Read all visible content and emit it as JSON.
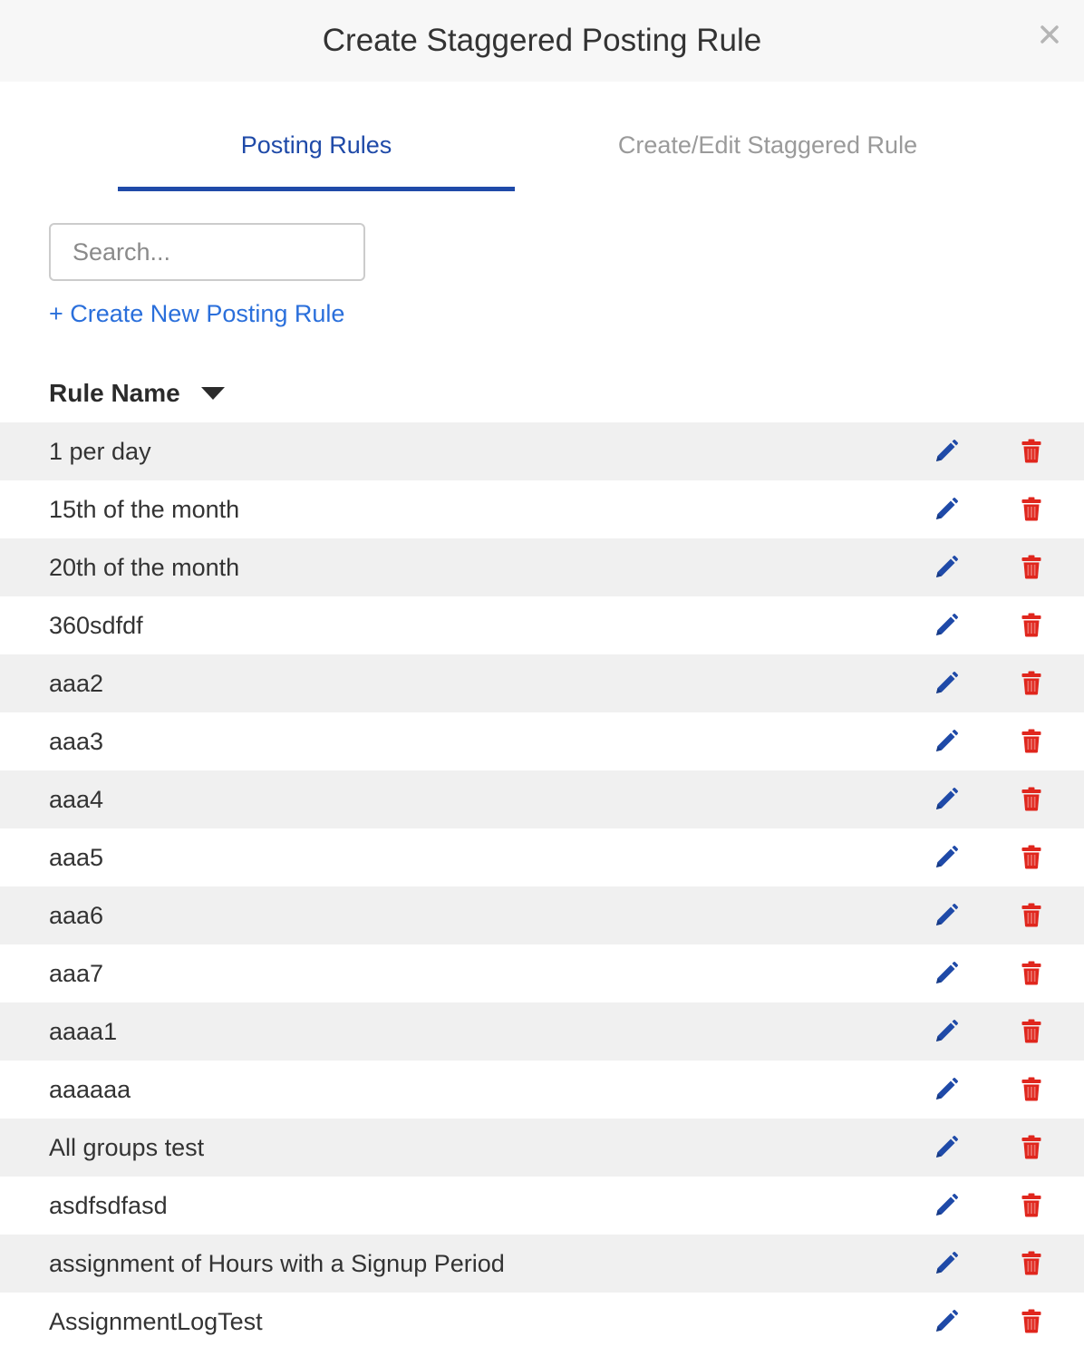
{
  "modal": {
    "title": "Create Staggered Posting Rule",
    "close_icon": "close-icon"
  },
  "tabs": [
    {
      "label": "Posting Rules",
      "active": true
    },
    {
      "label": "Create/Edit Staggered Rule",
      "active": false
    }
  ],
  "search": {
    "placeholder": "Search...",
    "value": ""
  },
  "create_link": "+ Create New Posting Rule",
  "table": {
    "column_header": "Rule Name",
    "sort_icon": "caret-down-icon",
    "rows": [
      {
        "name": "1 per day"
      },
      {
        "name": "15th of the month"
      },
      {
        "name": "20th of the month"
      },
      {
        "name": "360sdfdf"
      },
      {
        "name": "aaa2"
      },
      {
        "name": "aaa3"
      },
      {
        "name": "aaa4"
      },
      {
        "name": "aaa5"
      },
      {
        "name": "aaa6"
      },
      {
        "name": "aaa7"
      },
      {
        "name": "aaaa1"
      },
      {
        "name": "aaaaaa"
      },
      {
        "name": "All groups test"
      },
      {
        "name": "asdfsdfasd"
      },
      {
        "name": "assignment of Hours with a Signup Period"
      },
      {
        "name": "AssignmentLogTest"
      }
    ],
    "edit_icon": "pencil-icon",
    "delete_icon": "trash-icon"
  },
  "colors": {
    "accent": "#1f4aa8",
    "link": "#2a6fdb",
    "delete": "#e0261d",
    "row_alt": "#f0f0f0"
  }
}
